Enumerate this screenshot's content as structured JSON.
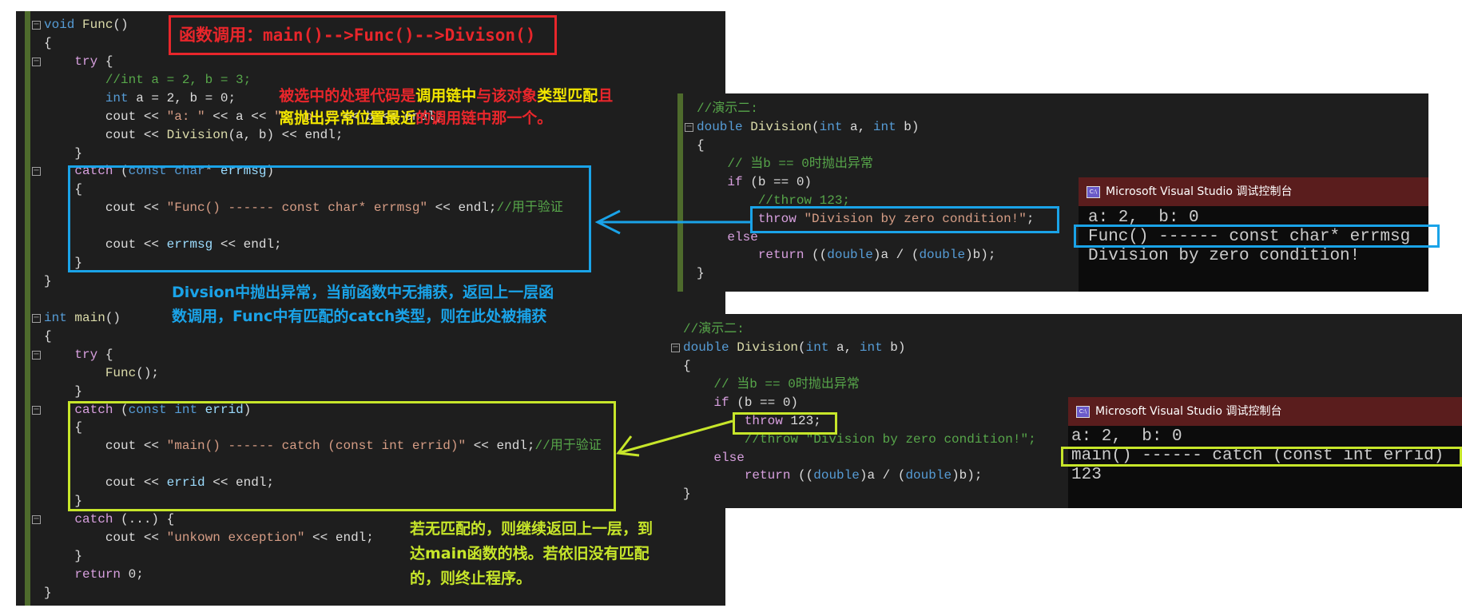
{
  "colors": {
    "editor_bg": "#1e1e1e",
    "console_bg": "#0c0c0c",
    "console_title_bg": "#5a1d1d",
    "red": "#e8262b",
    "blue": "#1aa3e8",
    "yellowgreen": "#c7e62a",
    "yellow": "#f2e600"
  },
  "left_editor": {
    "lines": [
      [
        [
          "void",
          "k"
        ],
        [
          " ",
          "p"
        ],
        [
          "Func",
          "f"
        ],
        [
          "()",
          "p"
        ]
      ],
      [
        [
          "{",
          "p"
        ]
      ],
      [
        [
          "    ",
          "p"
        ],
        [
          "try",
          "c"
        ],
        [
          " {",
          "p"
        ]
      ],
      [
        [
          "        //int a = 2, b = 3;",
          "cm"
        ]
      ],
      [
        [
          "        ",
          "p"
        ],
        [
          "int",
          "k"
        ],
        [
          " a = 2, b = 0;",
          "p"
        ]
      ],
      [
        [
          "        cout << ",
          "p"
        ],
        [
          "\"a: \"",
          "s"
        ],
        [
          " << a << ",
          "p"
        ],
        [
          "\",  b: \"",
          "s"
        ],
        [
          " << b << endl;",
          "p"
        ]
      ],
      [
        [
          "        cout << ",
          "p"
        ],
        [
          "Division",
          "f"
        ],
        [
          "(a, b) << endl;",
          "p"
        ]
      ],
      [
        [
          "    }",
          "p"
        ]
      ],
      [
        [
          "    ",
          "p"
        ],
        [
          "catch",
          "c"
        ],
        [
          " (",
          "p"
        ],
        [
          "const",
          "k"
        ],
        [
          " ",
          "p"
        ],
        [
          "char",
          "k"
        ],
        [
          "* ",
          "p"
        ],
        [
          "errmsg",
          "v"
        ],
        [
          ")",
          "p"
        ]
      ],
      [
        [
          "    {",
          "p"
        ]
      ],
      [
        [
          "        cout << ",
          "p"
        ],
        [
          "\"Func() ------ const char* errmsg\"",
          "s"
        ],
        [
          " << endl;",
          "p"
        ],
        [
          "//用于验证",
          "cm"
        ]
      ],
      [],
      [
        [
          "        cout << ",
          "p"
        ],
        [
          "errmsg",
          "v"
        ],
        [
          " << endl;",
          "p"
        ]
      ],
      [
        [
          "    }",
          "p"
        ]
      ],
      [
        [
          "}",
          "p"
        ]
      ],
      [],
      [
        [
          "int",
          "k"
        ],
        [
          " ",
          "p"
        ],
        [
          "main",
          "f"
        ],
        [
          "()",
          "p"
        ]
      ],
      [
        [
          "{",
          "p"
        ]
      ],
      [
        [
          "    ",
          "p"
        ],
        [
          "try",
          "c"
        ],
        [
          " {",
          "p"
        ]
      ],
      [
        [
          "        ",
          "p"
        ],
        [
          "Func",
          "f"
        ],
        [
          "();",
          "p"
        ]
      ],
      [
        [
          "    }",
          "p"
        ]
      ],
      [
        [
          "    ",
          "p"
        ],
        [
          "catch",
          "c"
        ],
        [
          " (",
          "p"
        ],
        [
          "const",
          "k"
        ],
        [
          " ",
          "p"
        ],
        [
          "int",
          "k"
        ],
        [
          " ",
          "p"
        ],
        [
          "errid",
          "v"
        ],
        [
          ")",
          "p"
        ]
      ],
      [
        [
          "    {",
          "p"
        ]
      ],
      [
        [
          "        cout << ",
          "p"
        ],
        [
          "\"main() ------ catch (const int errid)\"",
          "s"
        ],
        [
          " << endl;",
          "p"
        ],
        [
          "//用于验证",
          "cm"
        ]
      ],
      [],
      [
        [
          "        cout << ",
          "p"
        ],
        [
          "errid",
          "v"
        ],
        [
          " << endl;",
          "p"
        ]
      ],
      [
        [
          "    }",
          "p"
        ]
      ],
      [
        [
          "    ",
          "p"
        ],
        [
          "catch",
          "c"
        ],
        [
          " (...) {",
          "p"
        ]
      ],
      [
        [
          "        cout << ",
          "p"
        ],
        [
          "\"unkown exception\"",
          "s"
        ],
        [
          " << endl;",
          "p"
        ]
      ],
      [
        [
          "    }",
          "p"
        ]
      ],
      [
        [
          "    ",
          "p"
        ],
        [
          "return",
          "c"
        ],
        [
          " 0;",
          "p"
        ]
      ],
      [
        [
          "}",
          "p"
        ]
      ]
    ]
  },
  "demo_top": {
    "lines": [
      [
        [
          "//演示二:",
          "cm"
        ]
      ],
      [
        [
          "double",
          "k"
        ],
        [
          " ",
          "p"
        ],
        [
          "Division",
          "f"
        ],
        [
          "(",
          "p"
        ],
        [
          "int",
          "k"
        ],
        [
          " a, ",
          "p"
        ],
        [
          "int",
          "k"
        ],
        [
          " b)",
          "p"
        ]
      ],
      [
        [
          "{",
          "p"
        ]
      ],
      [
        [
          "    // 当b == 0时抛出异常",
          "cm"
        ]
      ],
      [
        [
          "    ",
          "p"
        ],
        [
          "if",
          "c"
        ],
        [
          " (b == 0)",
          "p"
        ]
      ],
      [
        [
          "        //throw 123;",
          "cm"
        ]
      ],
      [
        [
          "        ",
          "p"
        ],
        [
          "throw",
          "c"
        ],
        [
          " ",
          "p"
        ],
        [
          "\"Division by zero condition!\"",
          "s"
        ],
        [
          ";",
          "p"
        ]
      ],
      [
        [
          "    ",
          "p"
        ],
        [
          "else",
          "c"
        ]
      ],
      [
        [
          "        ",
          "p"
        ],
        [
          "return",
          "c"
        ],
        [
          " ((",
          "p"
        ],
        [
          "double",
          "k"
        ],
        [
          ")a / (",
          "p"
        ],
        [
          "double",
          "k"
        ],
        [
          ")b);",
          "p"
        ]
      ],
      [
        [
          "}",
          "p"
        ]
      ]
    ],
    "console_title": "Microsoft Visual Studio 调试控制台",
    "console_icon": "console-app-icon",
    "console_lines": [
      "a: 2,  b: 0",
      "Func() ------ const char* errmsg",
      "Division by zero condition!"
    ]
  },
  "demo_bottom": {
    "lines": [
      [
        [
          "//演示二:",
          "cm"
        ]
      ],
      [
        [
          "double",
          "k"
        ],
        [
          " ",
          "p"
        ],
        [
          "Division",
          "f"
        ],
        [
          "(",
          "p"
        ],
        [
          "int",
          "k"
        ],
        [
          " a, ",
          "p"
        ],
        [
          "int",
          "k"
        ],
        [
          " b)",
          "p"
        ]
      ],
      [
        [
          "{",
          "p"
        ]
      ],
      [
        [
          "    // 当b == 0时抛出异常",
          "cm"
        ]
      ],
      [
        [
          "    ",
          "p"
        ],
        [
          "if",
          "c"
        ],
        [
          " (b == 0)",
          "p"
        ]
      ],
      [
        [
          "        ",
          "p"
        ],
        [
          "throw",
          "c"
        ],
        [
          " 123;",
          "p"
        ]
      ],
      [
        [
          "        //throw \"Division by zero condition!\";",
          "cm"
        ]
      ],
      [
        [
          "    ",
          "p"
        ],
        [
          "else",
          "c"
        ]
      ],
      [
        [
          "        ",
          "p"
        ],
        [
          "return",
          "c"
        ],
        [
          " ((",
          "p"
        ],
        [
          "double",
          "k"
        ],
        [
          ")a / (",
          "p"
        ],
        [
          "double",
          "k"
        ],
        [
          ")b);",
          "p"
        ]
      ],
      [
        [
          "}",
          "p"
        ]
      ]
    ],
    "console_title": "Microsoft Visual Studio 调试控制台",
    "console_icon": "console-app-icon",
    "console_lines": [
      "a: 2,  b: 0",
      "main() ------ catch (const int errid)",
      "123"
    ]
  },
  "annotations": {
    "call_chain": "函数调用：main()-->Func()-->Divison()",
    "rule_line1_a": "被选中的处理代码是",
    "rule_line1_b": "调用链中",
    "rule_line1_c": "与该对象",
    "rule_line1_d": "类型匹配",
    "rule_line1_e": "且",
    "rule_line2_a": "离抛出异常位置最近",
    "rule_line2_b": "的调用链中那一个。",
    "blue_note_1": "Divsion中抛出异常，当前函数中无捕获，返回上一层函",
    "blue_note_2": "数调用，Func中有匹配的catch类型，则在此处被捕获",
    "green_note_1": "若无匹配的，则继续返回上一层，到",
    "green_note_2": "达main函数的栈。若依旧没有匹配",
    "green_note_3": "的，则终止程序。"
  }
}
